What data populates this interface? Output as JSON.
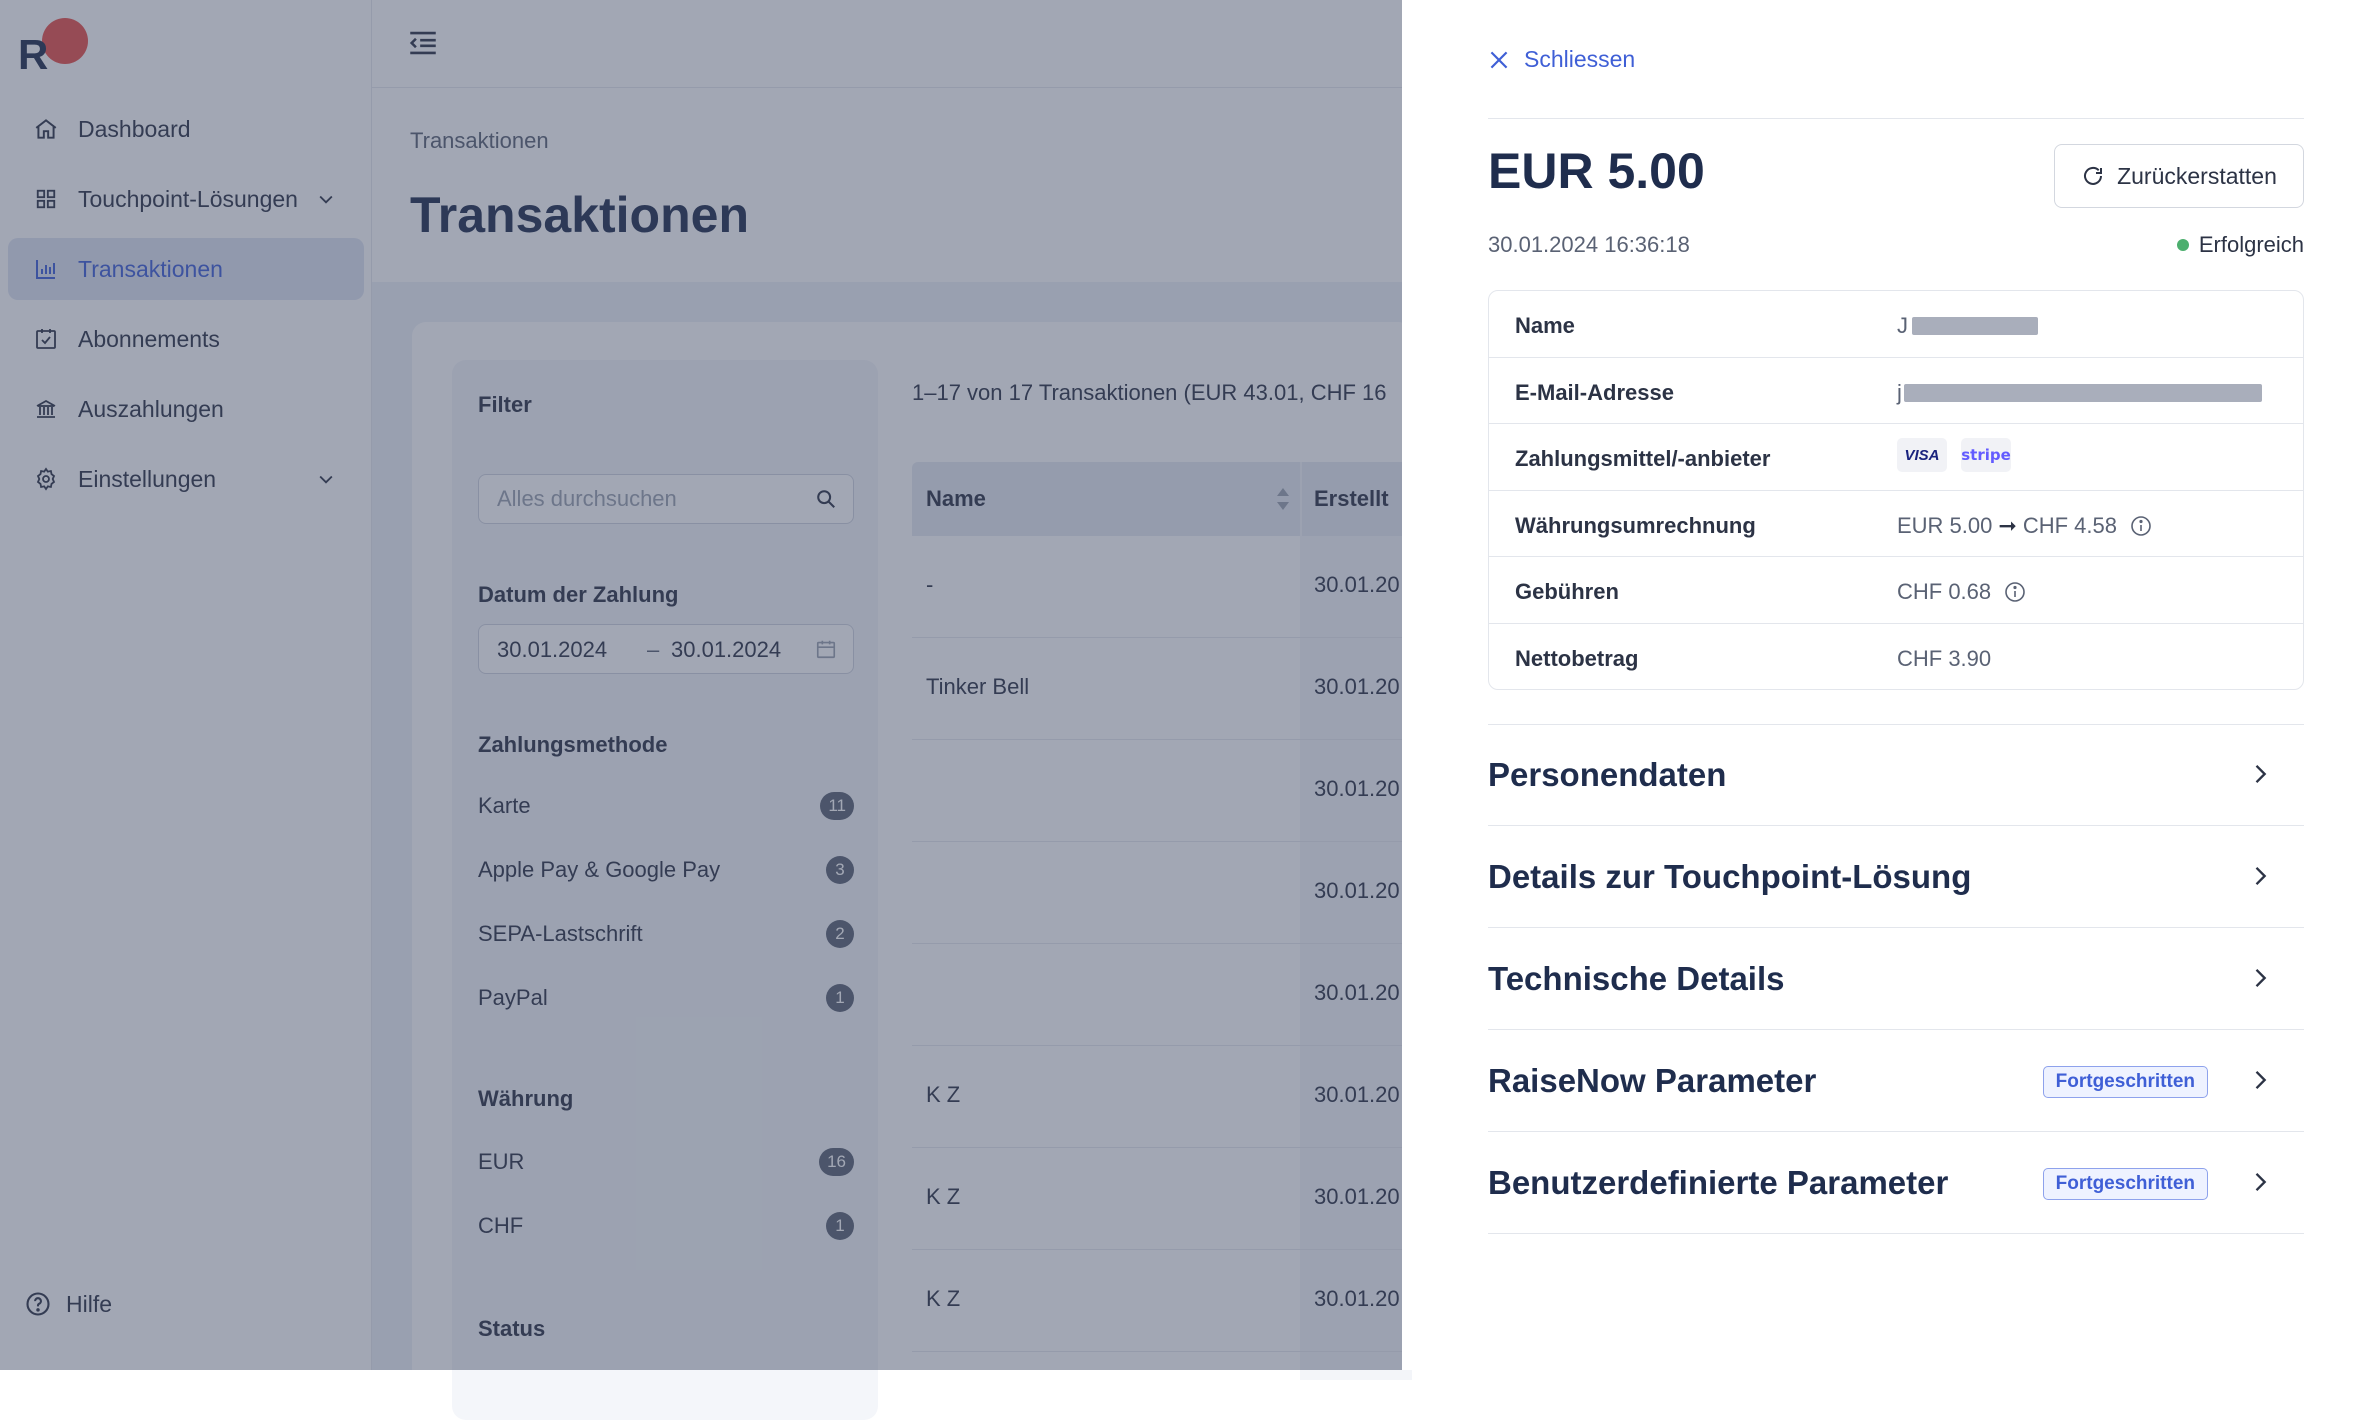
{
  "app": {
    "logo_letter": "R",
    "brand_colors": {
      "accent": "#3f5fd6",
      "logo_dot": "#e8504a",
      "success": "#4caf6e"
    }
  },
  "sidebar": {
    "items": [
      {
        "label": "Dashboard",
        "icon": "home-icon"
      },
      {
        "label": "Touchpoint-Lösungen",
        "icon": "grid-icon",
        "expandable": true
      },
      {
        "label": "Transaktionen",
        "icon": "bar-chart-icon",
        "active": true
      },
      {
        "label": "Abonnements",
        "icon": "calendar-check-icon"
      },
      {
        "label": "Auszahlungen",
        "icon": "bank-icon"
      },
      {
        "label": "Einstellungen",
        "icon": "gear-icon",
        "expandable": true
      }
    ],
    "help_label": "Hilfe"
  },
  "header": {
    "breadcrumb": "Transaktionen",
    "title": "Transaktionen"
  },
  "filter": {
    "title": "Filter",
    "search_placeholder": "Alles durchsuchen",
    "date_section": "Datum der Zahlung",
    "date_from": "30.01.2024",
    "date_sep": "–",
    "date_to": "30.01.2024",
    "payment_section": "Zahlungsmethode",
    "payment_methods": [
      {
        "label": "Karte",
        "count": "11"
      },
      {
        "label": "Apple Pay & Google Pay",
        "count": "3"
      },
      {
        "label": "SEPA-Lastschrift",
        "count": "2"
      },
      {
        "label": "PayPal",
        "count": "1"
      }
    ],
    "currency_section": "Währung",
    "currencies": [
      {
        "label": "EUR",
        "count": "16"
      },
      {
        "label": "CHF",
        "count": "1"
      }
    ],
    "status_section": "Status"
  },
  "table": {
    "summary": "1–17 von 17 Transaktionen (EUR 43.01, CHF 16",
    "col_name": "Name",
    "col_created": "Erstellt",
    "rows": [
      {
        "name": "-",
        "created": "30.01.20"
      },
      {
        "name": "Tinker Bell",
        "created": "30.01.20"
      },
      {
        "name": "",
        "created": "30.01.20"
      },
      {
        "name": "",
        "created": "30.01.20"
      },
      {
        "name": "",
        "created": "30.01.20"
      },
      {
        "name": "K Z",
        "created": "30.01.20"
      },
      {
        "name": "K Z",
        "created": "30.01.20"
      },
      {
        "name": "K Z",
        "created": "30.01.20"
      }
    ]
  },
  "drawer": {
    "close_label": "Schliessen",
    "amount": "EUR 5.00",
    "refund_label": "Zurückerstatten",
    "datetime": "30.01.2024 16:36:18",
    "status": "Erfolgreich",
    "details": {
      "name_key": "Name",
      "name_value_visible": "J",
      "email_key": "E-Mail-Adresse",
      "email_value_visible": "j",
      "payment_key": "Zahlungsmittel/-anbieter",
      "payment_brand_1": "VISA",
      "payment_brand_2": "stripe",
      "fx_key": "Währungsumrechnung",
      "fx_from": "EUR 5.00",
      "fx_arrow": "➞",
      "fx_to": "CHF 4.58",
      "fees_key": "Gebühren",
      "fees_value": "CHF 0.68",
      "net_key": "Nettobetrag",
      "net_value": "CHF 3.90"
    },
    "sections": [
      {
        "label": "Personendaten"
      },
      {
        "label": "Details zur Touchpoint-Lösung"
      },
      {
        "label": "Technische Details"
      },
      {
        "label": "RaiseNow Parameter",
        "tag": "Fortgeschritten"
      },
      {
        "label": "Benutzerdefinierte Parameter",
        "tag": "Fortgeschritten"
      }
    ]
  }
}
